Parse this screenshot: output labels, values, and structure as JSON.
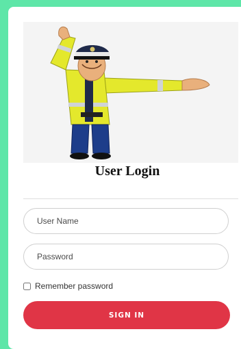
{
  "login": {
    "title": "User Login",
    "username_placeholder": "User Name",
    "password_placeholder": "Password",
    "remember_label": "Remember password",
    "remember_checked": false,
    "signin_label": "SIGN IN"
  },
  "hero": {
    "icon": "traffic-police-officer-illustration"
  },
  "colors": {
    "page_background": "#5ee6a8",
    "card_background": "#ffffff",
    "signin_button": "#e03546",
    "vest": "#e4e82c"
  }
}
